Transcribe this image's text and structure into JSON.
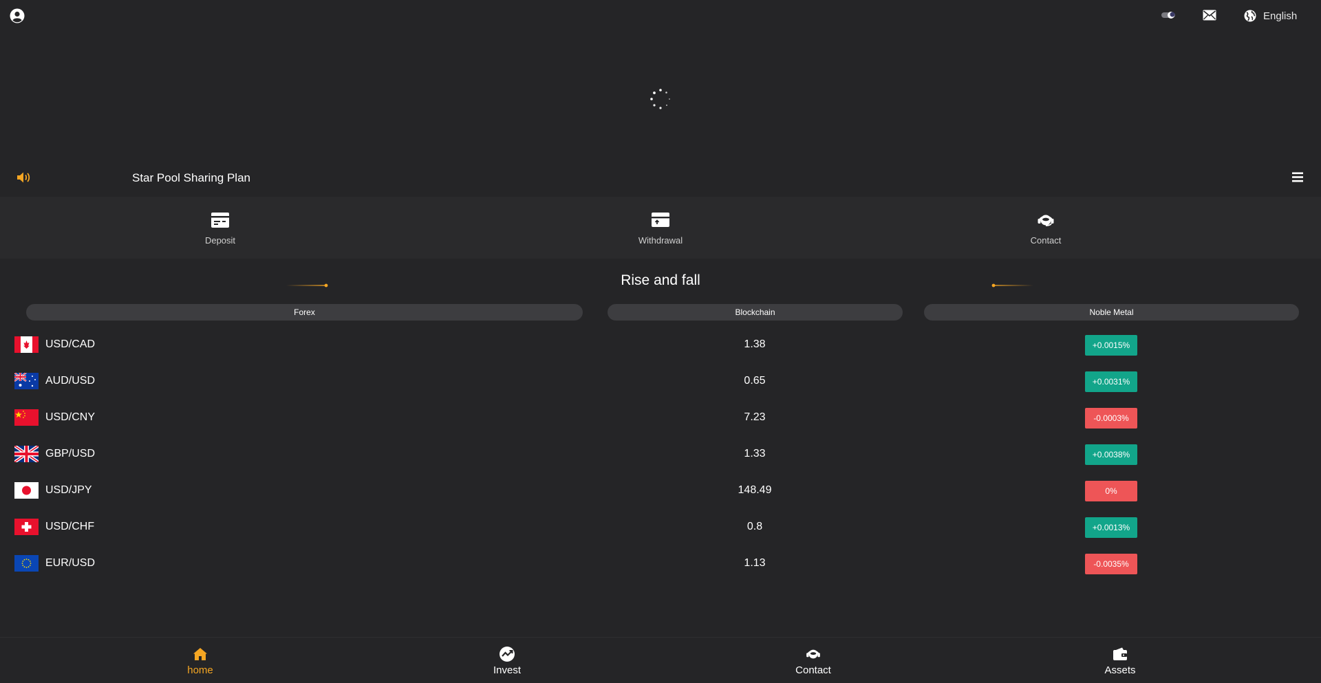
{
  "header": {
    "language_label": "English",
    "icons": [
      "user-icon",
      "theme-toggle-icon",
      "mail-icon",
      "globe-icon"
    ]
  },
  "notice": {
    "text": "Star Pool Sharing Plan"
  },
  "actions": [
    {
      "label": "Deposit",
      "icon": "deposit-card-icon"
    },
    {
      "label": "Withdrawal",
      "icon": "withdrawal-card-icon"
    },
    {
      "label": "Contact",
      "icon": "headset-icon"
    }
  ],
  "market": {
    "title": "Rise and fall",
    "columns": [
      "Forex",
      "Blockchain",
      "Noble Metal"
    ],
    "rows": [
      {
        "pair": "USD/CAD",
        "price": "1.38",
        "change": "+0.0015%",
        "direction": "up",
        "flag": "canada-flag"
      },
      {
        "pair": "AUD/USD",
        "price": "0.65",
        "change": "+0.0031%",
        "direction": "up",
        "flag": "australia-flag"
      },
      {
        "pair": "USD/CNY",
        "price": "7.23",
        "change": "-0.0003%",
        "direction": "down",
        "flag": "china-flag"
      },
      {
        "pair": "GBP/USD",
        "price": "1.33",
        "change": "+0.0038%",
        "direction": "up",
        "flag": "uk-flag"
      },
      {
        "pair": "USD/JPY",
        "price": "148.49",
        "change": "0%",
        "direction": "down",
        "flag": "japan-flag"
      },
      {
        "pair": "USD/CHF",
        "price": "0.8",
        "change": "+0.0013%",
        "direction": "up",
        "flag": "switzerland-flag"
      },
      {
        "pair": "EUR/USD",
        "price": "1.13",
        "change": "-0.0035%",
        "direction": "down",
        "flag": "eu-flag"
      }
    ]
  },
  "bottom_nav": [
    {
      "label": "home",
      "icon": "home-icon",
      "active": true
    },
    {
      "label": "Invest",
      "icon": "invest-icon",
      "active": false
    },
    {
      "label": "Contact",
      "icon": "headset-icon",
      "active": false
    },
    {
      "label": "Assets",
      "icon": "wallet-icon",
      "active": false
    }
  ],
  "colors": {
    "background": "#252527",
    "accent": "#f5a623",
    "up": "#12a58a",
    "down": "#ee5557",
    "pill": "#3d3d40"
  }
}
